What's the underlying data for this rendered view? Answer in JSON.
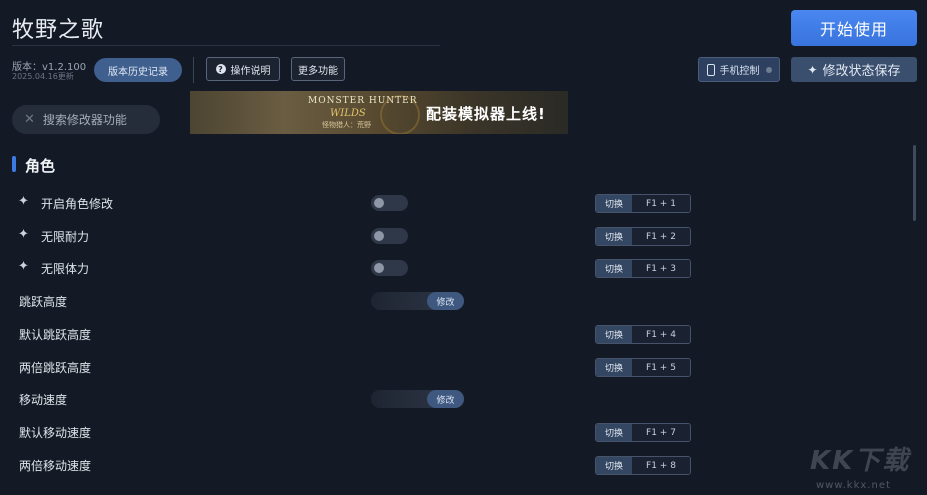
{
  "app": {
    "title": "牧野之歌",
    "version": "版本：v1.2.100",
    "update_date": "2025.04.16更新"
  },
  "header": {
    "history_label": "版本历史记录",
    "help_label": "操作说明",
    "help_icon_glyph": "?",
    "more_label": "更多功能",
    "start_label": "开始使用",
    "phone_label": "手机控制",
    "save_label": "修改状态保存",
    "save_icon_glyph": "✦"
  },
  "search": {
    "icon_glyph": "✕",
    "placeholder": "搜索修改器功能"
  },
  "banner": {
    "logo_line1": "MONSTER HUNTER",
    "logo_line2": "WILDS",
    "logo_line3": "怪物猎人：荒野",
    "promo_text": "配装模拟器上线!"
  },
  "section": {
    "title": "角色"
  },
  "sparkle_glyph": "✦",
  "rows": [
    {
      "label": "开启角色修改",
      "sparkle": true,
      "control": "toggle",
      "on": false,
      "switch_label": "切换",
      "hotkey": "F1 + 1"
    },
    {
      "label": "无限耐力",
      "sparkle": true,
      "control": "toggle",
      "on": false,
      "switch_label": "切换",
      "hotkey": "F1 + 2"
    },
    {
      "label": "无限体力",
      "sparkle": true,
      "control": "toggle",
      "on": false,
      "switch_label": "切换",
      "hotkey": "F1 + 3"
    },
    {
      "label": "跳跃高度",
      "sparkle": false,
      "control": "slider",
      "modify_label": "修改"
    },
    {
      "label": "默认跳跃高度",
      "sparkle": false,
      "control": "none",
      "switch_label": "切换",
      "hotkey": "F1 + 4"
    },
    {
      "label": "两倍跳跃高度",
      "sparkle": false,
      "control": "none",
      "switch_label": "切换",
      "hotkey": "F1 + 5"
    },
    {
      "label": "移动速度",
      "sparkle": false,
      "control": "slider",
      "modify_label": "修改"
    },
    {
      "label": "默认移动速度",
      "sparkle": false,
      "control": "none",
      "switch_label": "切换",
      "hotkey": "F1 + 7"
    },
    {
      "label": "两倍移动速度",
      "sparkle": false,
      "control": "none",
      "switch_label": "切换",
      "hotkey": "F1 + 8"
    }
  ],
  "watermark": {
    "logo": "KK下载",
    "url": "www.kkx.net"
  },
  "colors": {
    "background": "#141a25",
    "accent": "#3d7be3",
    "button_primary": "#4a87f0"
  }
}
